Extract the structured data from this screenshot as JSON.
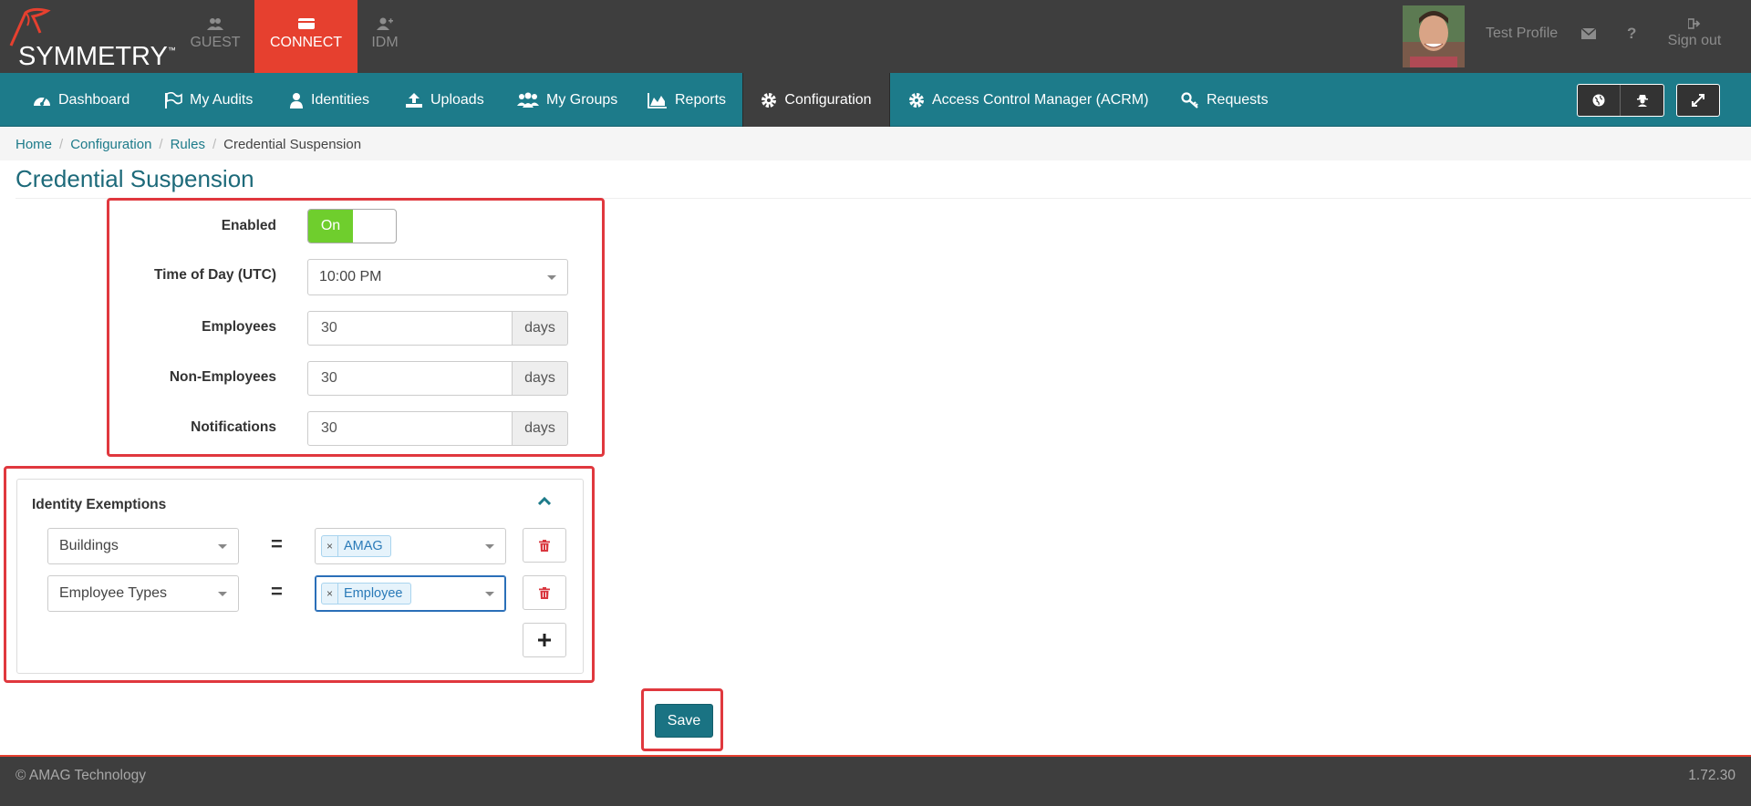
{
  "brand": {
    "name": "SYMMETRY",
    "tm": "™"
  },
  "modules": [
    {
      "label": "GUEST",
      "icon": "users-icon"
    },
    {
      "label": "CONNECT",
      "icon": "card-icon"
    },
    {
      "label": "IDM",
      "icon": "user-plus-icon"
    }
  ],
  "topbar_right": {
    "profile": "Test Profile",
    "signout": "Sign out"
  },
  "nav": {
    "items": [
      {
        "label": "Dashboard",
        "icon": "dashboard-icon"
      },
      {
        "label": "My Audits",
        "icon": "flag-icon"
      },
      {
        "label": "Identities",
        "icon": "user-icon"
      },
      {
        "label": "Uploads",
        "icon": "upload-icon"
      },
      {
        "label": "My Groups",
        "icon": "group-icon"
      },
      {
        "label": "Reports",
        "icon": "area-chart-icon"
      },
      {
        "label": "Configuration",
        "icon": "gear-icon"
      },
      {
        "label": "Access Control Manager (ACRM)",
        "icon": "gear-icon"
      },
      {
        "label": "Requests",
        "icon": "key-icon"
      }
    ],
    "active": "Configuration"
  },
  "breadcrumb": [
    "Home",
    "Configuration",
    "Rules",
    "Credential Suspension"
  ],
  "page_title": "Credential Suspension",
  "form": {
    "enabled_label": "Enabled",
    "enabled_value": "On",
    "time_label": "Time of Day (UTC)",
    "time_value": "10:00 PM",
    "employees_label": "Employees",
    "employees_value": "30",
    "non_employees_label": "Non-Employees",
    "non_employees_value": "30",
    "notifications_label": "Notifications",
    "notifications_value": "30",
    "unit": "days"
  },
  "exemptions": {
    "title": "Identity Exemptions",
    "rows": [
      {
        "field": "Buildings",
        "operator": "=",
        "value": "AMAG"
      },
      {
        "field": "Employee Types",
        "operator": "=",
        "value": "Employee"
      }
    ],
    "tag_remove": "×"
  },
  "save_label": "Save",
  "footer": {
    "copyright": "© AMAG Technology",
    "version": "1.72.30"
  },
  "colors": {
    "teal": "#1d7b8a",
    "red": "#e6402f",
    "dark": "#3e3e3e",
    "toggle_green": "#6fce2d",
    "highlight": "#e0383e"
  }
}
